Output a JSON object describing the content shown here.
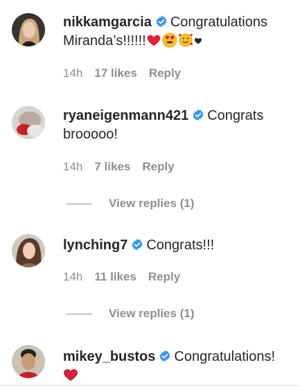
{
  "comments": [
    {
      "username": "nikkamgarcia",
      "text": "Congratulations Miranda’s!!!!!!",
      "emojis": [
        "red-heart",
        "heart-eyes",
        "smiling-face-with-hearts",
        "black-heart"
      ],
      "time": "14h",
      "likes": "17 likes",
      "reply": "Reply"
    },
    {
      "username": "ryaneigenmann421",
      "text": "Congrats brooooo!",
      "time": "14h",
      "likes": "7 likes",
      "reply": "Reply",
      "view_replies": "View replies (1)"
    },
    {
      "username": "lynching7",
      "text": "Congrats!!!",
      "time": "14h",
      "likes": "11 likes",
      "reply": "Reply",
      "view_replies": "View replies (1)"
    },
    {
      "username": "mikey_bustos",
      "text": "Congratulations!",
      "emojis": [
        "red-heart"
      ]
    }
  ],
  "colors": {
    "verified": "#3897f0",
    "meta_text": "#8e8e8e",
    "body_text": "#262626",
    "heart": "#e0203a"
  }
}
